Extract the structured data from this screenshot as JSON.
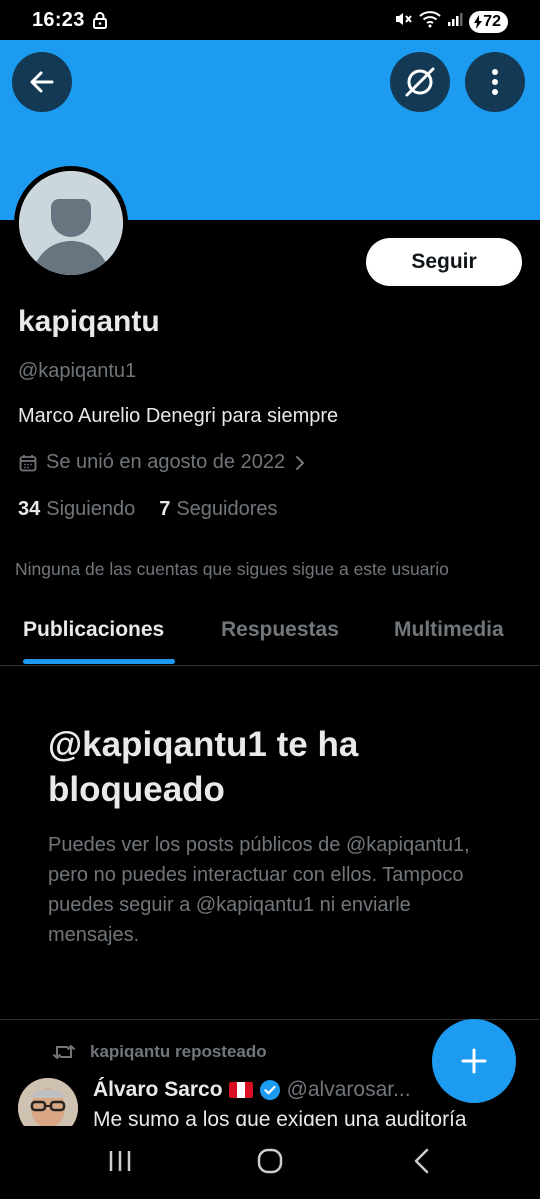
{
  "status_bar": {
    "time": "16:23",
    "battery": "72"
  },
  "profile": {
    "follow_label": "Seguir",
    "display_name": "kapiqantu",
    "handle": "@kapiqantu1",
    "bio": "Marco Aurelio Denegri para siempre",
    "joined": "Se unió en agosto de 2022",
    "following_count": "34",
    "following_label": "Siguiendo",
    "followers_count": "7",
    "followers_label": "Seguidores",
    "no_mutuals": "Ninguna de las cuentas que sigues sigue a este usuario"
  },
  "tabs": [
    "Publicaciones",
    "Respuestas",
    "Multimedia"
  ],
  "blocked": {
    "title": "@kapiqantu1 te ha bloqueado",
    "description": "Puedes ver los posts públicos de @kapiqantu1, pero no puedes interactuar con ellos. Tampoco puedes seguir a @kapiqantu1 ni enviarle mensajes."
  },
  "tweet": {
    "repost_label": "kapiqantu reposteado",
    "author_name": "Álvaro Sarco",
    "author_handle": "@alvarosar...",
    "text": "Me sumo a los que exigen una auditoría"
  },
  "icons": {
    "back": "arrow-left-icon",
    "grok": "grok-icon",
    "more": "more-vertical-icon",
    "calendar": "calendar-icon",
    "chevron": "chevron-right-icon",
    "repost": "repost-icon",
    "verified": "verified-badge-icon",
    "compose": "plus-icon"
  },
  "colors": {
    "accent": "#1d9bf0",
    "background": "#000000",
    "muted_text": "#71767b"
  }
}
